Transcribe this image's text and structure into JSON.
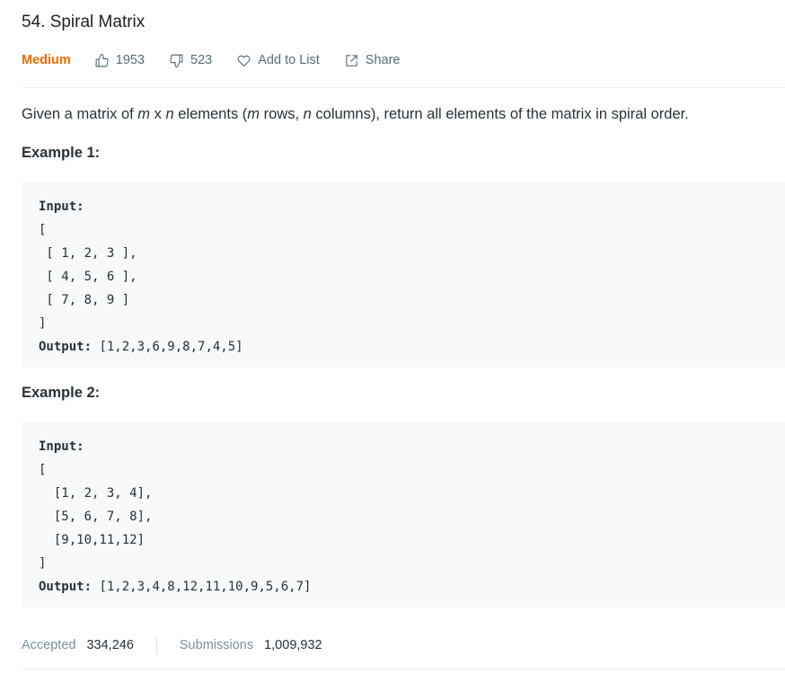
{
  "problem": {
    "title": "54. Spiral Matrix",
    "difficulty": "Medium",
    "likes": "1953",
    "dislikes": "523",
    "add_to_list_label": "Add to List",
    "share_label": "Share"
  },
  "description": {
    "part1": "Given a matrix of ",
    "m": "m",
    "x": " x ",
    "n": "n",
    "part2": " elements (",
    "m2": "m",
    "part3": " rows, ",
    "n2": "n",
    "part4": " columns), return all elements of the matrix in spiral order."
  },
  "examples": [
    {
      "heading": "Example 1:",
      "input_label": "Input:",
      "input_lines": "[\n [ 1, 2, 3 ],\n [ 4, 5, 6 ],\n [ 7, 8, 9 ]\n]",
      "output_label": "Output:",
      "output_value": " [1,2,3,6,9,8,7,4,5]"
    },
    {
      "heading": "Example 2:",
      "input_label": "Input:",
      "input_lines": "[\n  [1, 2, 3, 4],\n  [5, 6, 7, 8],\n  [9,10,11,12]\n]",
      "output_label": "Output:",
      "output_value": " [1,2,3,4,8,12,11,10,9,5,6,7]"
    }
  ],
  "stats": {
    "accepted_label": "Accepted",
    "accepted_value": "334,246",
    "submissions_label": "Submissions",
    "submissions_value": "1,009,932"
  },
  "icons": {
    "like": "thumbs-up-icon",
    "dislike": "thumbs-down-icon",
    "add_to_list": "heart-icon",
    "share": "share-icon"
  },
  "colors": {
    "difficulty_medium": "#ef6c00",
    "code_background": "#f7f9fa",
    "meta_text": "#546e7a"
  }
}
